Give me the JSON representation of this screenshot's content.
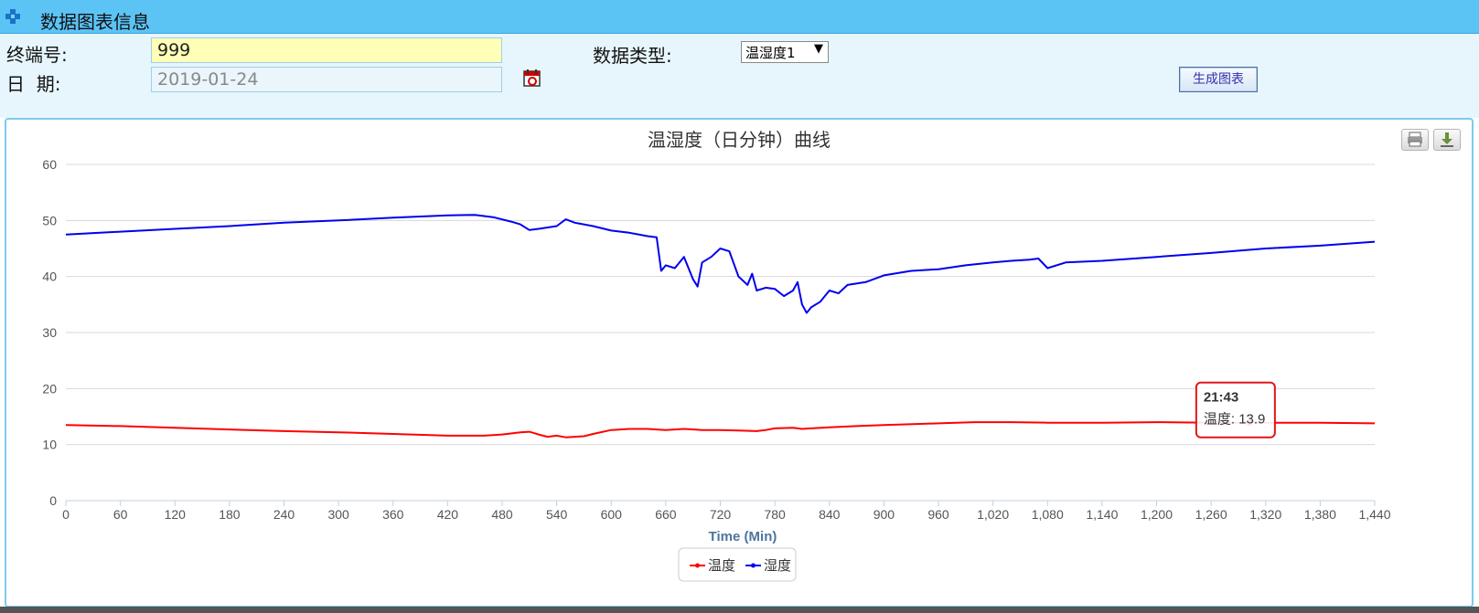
{
  "header": {
    "title": "数据图表信息",
    "icon": "plus-icon"
  },
  "form": {
    "terminal_label": "终端号:",
    "terminal_value": "999",
    "date_label": "日  期:",
    "date_value": "2019-01-24",
    "data_type_label": "数据类型:",
    "data_type_value": "温湿度1",
    "generate_button": "生成图表"
  },
  "chart_data": {
    "type": "line",
    "title": "温湿度（日分钟）曲线",
    "xlabel": "Time (Min)",
    "ylabel": "",
    "xlim": [
      0,
      1440
    ],
    "ylim": [
      0,
      60
    ],
    "x_ticks": [
      "0",
      "60",
      "120",
      "180",
      "240",
      "300",
      "360",
      "420",
      "480",
      "540",
      "600",
      "660",
      "720",
      "780",
      "840",
      "900",
      "960",
      "1,020",
      "1,080",
      "1,140",
      "1,200",
      "1,260",
      "1,320",
      "1,380",
      "1,440"
    ],
    "y_ticks": [
      "0",
      "10",
      "20",
      "30",
      "40",
      "50",
      "60"
    ],
    "grid": "horizontal",
    "legend_position": "bottom-center",
    "series": [
      {
        "name": "温度",
        "color": "#ff0000",
        "x": [
          0,
          60,
          120,
          180,
          240,
          300,
          360,
          420,
          460,
          480,
          500,
          510,
          520,
          530,
          540,
          550,
          560,
          570,
          580,
          600,
          620,
          640,
          660,
          680,
          700,
          720,
          740,
          760,
          770,
          780,
          800,
          810,
          820,
          840,
          870,
          900,
          940,
          960,
          1000,
          1040,
          1080,
          1140,
          1200,
          1260,
          1302,
          1380,
          1440
        ],
        "y": [
          13.5,
          13.3,
          13.0,
          12.7,
          12.4,
          12.2,
          11.9,
          11.6,
          11.6,
          11.8,
          12.2,
          12.3,
          11.8,
          11.4,
          11.6,
          11.3,
          11.4,
          11.5,
          11.9,
          12.6,
          12.8,
          12.8,
          12.6,
          12.8,
          12.6,
          12.6,
          12.5,
          12.4,
          12.6,
          12.9,
          13.0,
          12.8,
          12.9,
          13.1,
          13.3,
          13.5,
          13.7,
          13.8,
          14.0,
          14.0,
          13.9,
          13.9,
          14.0,
          13.9,
          13.9,
          13.9,
          13.8
        ]
      },
      {
        "name": "湿度",
        "color": "#0000ee",
        "x": [
          0,
          60,
          120,
          180,
          240,
          300,
          360,
          420,
          450,
          470,
          490,
          500,
          510,
          520,
          540,
          550,
          560,
          580,
          600,
          620,
          640,
          650,
          655,
          660,
          670,
          680,
          690,
          695,
          700,
          710,
          720,
          730,
          740,
          750,
          755,
          760,
          770,
          780,
          790,
          800,
          805,
          810,
          815,
          820,
          830,
          840,
          850,
          860,
          880,
          900,
          930,
          960,
          990,
          1020,
          1040,
          1060,
          1070,
          1080,
          1100,
          1140,
          1200,
          1260,
          1320,
          1380,
          1440
        ],
        "y": [
          47.5,
          48.0,
          48.5,
          49.0,
          49.6,
          50.0,
          50.5,
          50.9,
          51.0,
          50.6,
          49.8,
          49.3,
          48.3,
          48.5,
          49.0,
          50.2,
          49.6,
          49.0,
          48.2,
          47.8,
          47.2,
          47.0,
          41.0,
          42.0,
          41.5,
          43.5,
          39.5,
          38.2,
          42.5,
          43.5,
          45.0,
          44.5,
          40.0,
          38.5,
          40.5,
          37.5,
          38.0,
          37.8,
          36.5,
          37.5,
          39.0,
          35.0,
          33.5,
          34.5,
          35.5,
          37.5,
          37.0,
          38.5,
          39.0,
          40.2,
          41.0,
          41.3,
          42.0,
          42.5,
          42.8,
          43.0,
          43.2,
          41.5,
          42.5,
          42.8,
          43.5,
          44.2,
          45.0,
          45.5,
          46.2
        ]
      }
    ],
    "tooltip": {
      "title": "21:43",
      "label": "温度:",
      "value": "13.9",
      "x": 1302,
      "y": 13.9
    }
  }
}
